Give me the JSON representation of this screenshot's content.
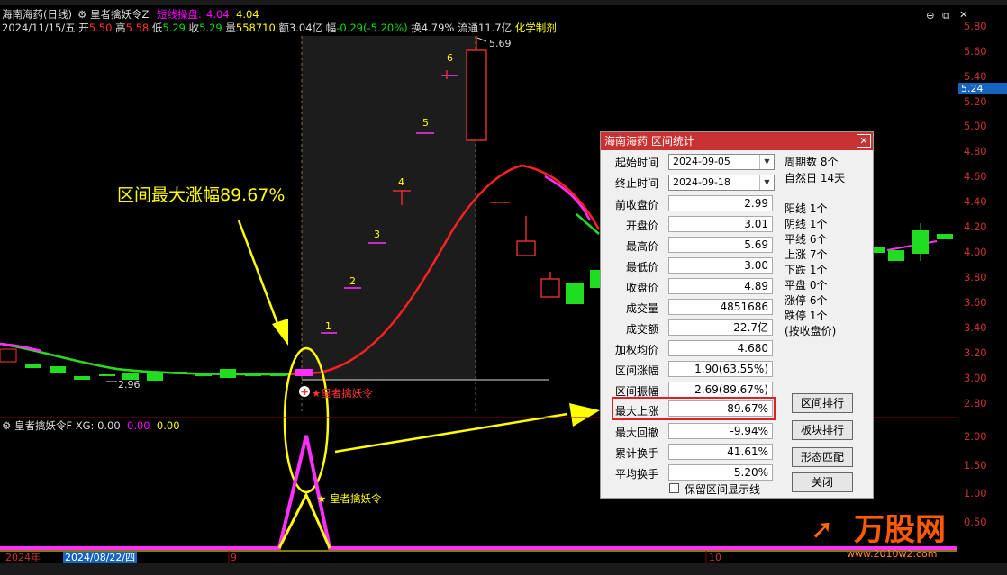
{
  "header": {
    "stock_title": "海南海药(日线)",
    "indicator_name": "皇者擒妖令Z",
    "indicator_line_label": "短线操盘:",
    "indicator_line_value": "4.04",
    "indicator_extra": "4.04",
    "date": "2024/11/15/五",
    "open_label": "开",
    "open": "5.50",
    "high_label": "高",
    "high": "5.58",
    "low_label": "低",
    "low": "5.29",
    "close_label": "收",
    "close": "5.29",
    "volume_label": "量",
    "volume": "558710",
    "amount_label": "额",
    "amount": "3.04亿",
    "change_label": "幅",
    "change": "-0.29(-5.20%)",
    "turnover_label": "换",
    "turnover": "4.79%",
    "float_label": "流通",
    "float": "11.7亿",
    "sector": "化学制剂"
  },
  "price_axis": {
    "ticks": [
      "5.80",
      "5.60",
      "5.40",
      "5.20",
      "5.00",
      "4.80",
      "4.60",
      "4.40",
      "4.20",
      "4.00",
      "3.80",
      "3.60",
      "3.40",
      "3.20",
      "3.00",
      "2.80"
    ],
    "current_price": "5.24"
  },
  "sub_axis": {
    "ticks": [
      "2.00",
      "1.50",
      "1.00",
      "0.50"
    ]
  },
  "annotations": {
    "big_label": "区间最大涨幅89.67%",
    "high_marker": "5.69",
    "low_marker": "2.96",
    "signal_label": "皇者擒妖令",
    "signal_label2": "皇者擒妖令",
    "wave_numbers": [
      "1",
      "2",
      "3",
      "4",
      "5",
      "6"
    ]
  },
  "sub_panel": {
    "name": "皇者擒妖令F",
    "xg_label": "XG:",
    "xg_value": "0.00",
    "v2": "0.00",
    "v3": "0.00"
  },
  "time_axis": {
    "year_label": "2024年",
    "cursor_date": "2024/08/22/四",
    "month_9": "9",
    "month_10": "10"
  },
  "dialog": {
    "title": "海南海药 区间统计",
    "start_label": "起始时间",
    "start_value": "2024-09-05",
    "end_label": "终止时间",
    "end_value": "2024-09-18",
    "rows": [
      {
        "label": "前收盘价",
        "value": "2.99"
      },
      {
        "label": "开盘价",
        "value": "3.01"
      },
      {
        "label": "最高价",
        "value": "5.69"
      },
      {
        "label": "最低价",
        "value": "3.00"
      },
      {
        "label": "收盘价",
        "value": "4.89"
      },
      {
        "label": "成交量",
        "value": "4851686"
      },
      {
        "label": "成交额",
        "value": "22.7亿"
      },
      {
        "label": "加权均价",
        "value": "4.680"
      },
      {
        "label": "区间涨幅",
        "value": "1.90(63.55%)"
      },
      {
        "label": "区间振幅",
        "value": "2.69(89.67%)"
      },
      {
        "label": "最大上涨",
        "value": "89.67%"
      },
      {
        "label": "最大回撤",
        "value": "-9.94%"
      },
      {
        "label": "累计换手",
        "value": "41.61%"
      },
      {
        "label": "平均换手",
        "value": "5.20%"
      }
    ],
    "stats": [
      "周期数 8个",
      "自然日 14天",
      "阳线 1个",
      "阴线 1个",
      "平线 6个",
      "上涨 7个",
      "下跌 1个",
      "平盘 0个",
      "涨停 6个",
      "跌停 1个",
      "(按收盘价)"
    ],
    "buttons": {
      "rank": "区间排行",
      "sector_rank": "板块排行",
      "pattern": "形态匹配",
      "close": "关闭"
    },
    "checkbox_label": "保留区间显示线"
  },
  "watermark": {
    "brand": "万股网",
    "url": "www.2010w2.com"
  },
  "colors": {
    "up": "#ff3232",
    "down": "#00e000",
    "accent_yellow": "#ffff00",
    "magenta": "#ff00ff",
    "dialog_title": "#c83232"
  }
}
